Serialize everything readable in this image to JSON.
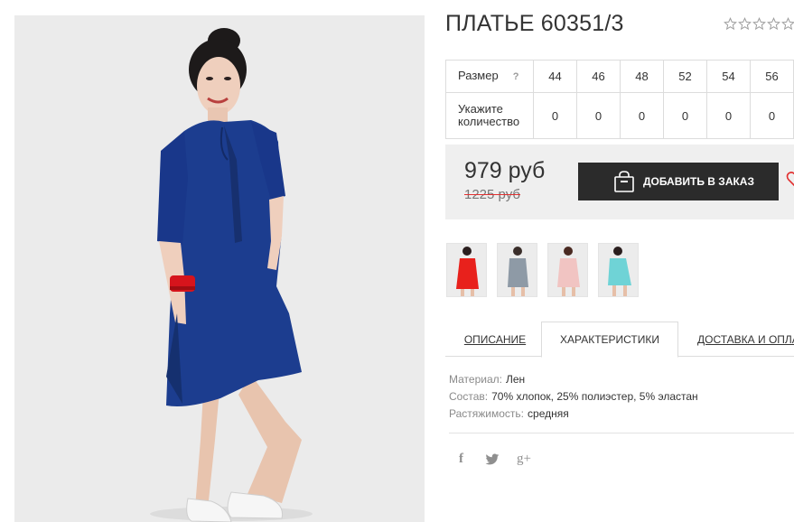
{
  "product": {
    "title": "ПЛАТЬЕ 60351/3",
    "rating_stars": 5,
    "rating_filled": 0
  },
  "size_table": {
    "size_label": "Размер",
    "help_icon": "?",
    "qty_label": "Укажите количество",
    "sizes": [
      "44",
      "46",
      "48",
      "52",
      "54",
      "56"
    ],
    "quantities": [
      "0",
      "0",
      "0",
      "0",
      "0",
      "0"
    ]
  },
  "price": {
    "current": "979 руб",
    "old": "1225 руб",
    "add_button": "ДОБАВИТЬ В ЗАКАЗ"
  },
  "thumbnails": [
    {
      "name": "thumb-red",
      "color": "#e8211c"
    },
    {
      "name": "thumb-gray",
      "color": "#8e9aa6"
    },
    {
      "name": "thumb-pink",
      "color": "#f1c4c2"
    },
    {
      "name": "thumb-mint",
      "color": "#6fd3d6"
    }
  ],
  "tabs": {
    "description": "ОПИСАНИЕ",
    "characteristics": "ХАРАКТЕРИСТИКИ",
    "delivery": "ДОСТАВКА И ОПЛАТА"
  },
  "specs": [
    {
      "key": "Материал:",
      "value": "Лен"
    },
    {
      "key": "Состав:",
      "value": "70% хлопок, 25% полиэстер, 5% эластан"
    },
    {
      "key": "Растяжимость:",
      "value": "средняя"
    }
  ],
  "social": {
    "facebook": "f",
    "google_plus": "g+"
  },
  "colors": {
    "dress": "#1c3d8f",
    "button": "#2b2b2b",
    "old_price_strike": "#e23030",
    "heart": "#e23030"
  }
}
